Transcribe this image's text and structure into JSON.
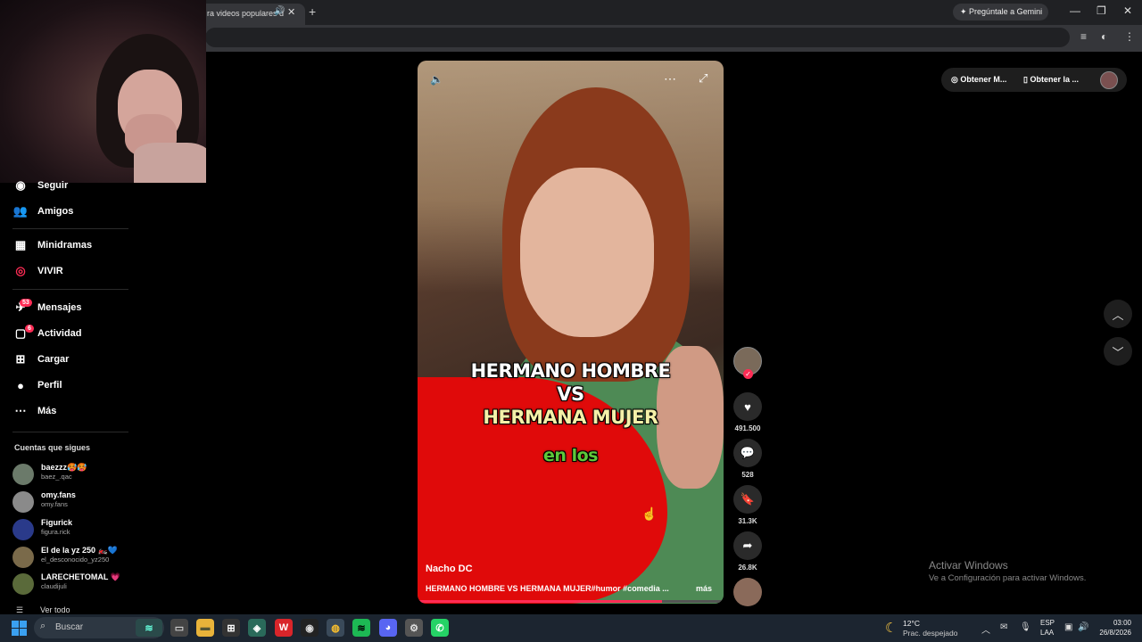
{
  "browser": {
    "tab_title": "ra videos populares d",
    "gemini_label": "Pregúntale a Gemini"
  },
  "sidebar": {
    "items": [
      {
        "label": "Seguir",
        "icon": "following-icon"
      },
      {
        "label": "Amigos",
        "icon": "friends-icon"
      },
      {
        "label": "Minidramas",
        "icon": "minidramas-icon"
      },
      {
        "label": "VIVIR",
        "icon": "live-icon"
      },
      {
        "label": "Mensajes",
        "icon": "messages-icon",
        "badge": "53"
      },
      {
        "label": "Actividad",
        "icon": "activity-icon",
        "badge": "6"
      },
      {
        "label": "Cargar",
        "icon": "upload-icon"
      },
      {
        "label": "Perfil",
        "icon": "profile-icon"
      },
      {
        "label": "Más",
        "icon": "more-icon"
      }
    ],
    "following_title": "Cuentas que sigues",
    "accounts": [
      {
        "name": "baezzz🥵🥵",
        "handle": "baez_.qac"
      },
      {
        "name": "omy.fans",
        "handle": "omy.fans"
      },
      {
        "name": "Figurick",
        "handle": "figura.rick"
      },
      {
        "name": "El de la yz 250 🏍️💙",
        "handle": "el_desconocido_yz250"
      },
      {
        "name": "LARECHETOMAL 💗",
        "handle": "claudijuli"
      }
    ],
    "see_all": "Ver todo"
  },
  "video": {
    "caption_line1": "HERMANO HOMBRE",
    "caption_line2": "VS",
    "caption_line3": "HERMANA MUJER",
    "caption_line4": "en los",
    "author": "Nacho DC",
    "description": "HERMANO HOMBRE VS HERMANA MUJER#humor #comedia ...",
    "more": "más",
    "progress": 0.8
  },
  "actions": {
    "likes": "491.500",
    "comments": "528",
    "saves": "31.3K",
    "shares": "26.8K"
  },
  "top_right": {
    "btn1": "Obtener M...",
    "btn2": "Obtener la ..."
  },
  "windows_activation": {
    "line1": "Activar Windows",
    "line2": "Ve a Configuración para activar Windows."
  },
  "taskbar": {
    "search": "Buscar",
    "weather_temp": "12°C",
    "weather_desc": "Prac. despejado",
    "lang1": "ESP",
    "lang2": "LAA",
    "time": "03:00",
    "date": "26/8/2026"
  },
  "colors": {
    "accent": "#fe2c55",
    "background": "#000000",
    "taskbar": "#1c2530"
  }
}
